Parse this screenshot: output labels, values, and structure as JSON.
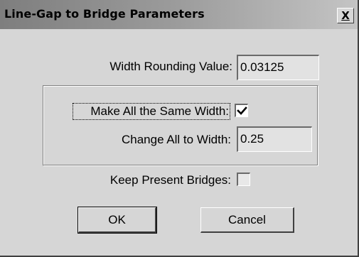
{
  "window": {
    "title": "Line-Gap to Bridge Parameters",
    "close_label": "X"
  },
  "form": {
    "width_rounding_label": "Width Rounding Value:",
    "width_rounding_value": "0.03125",
    "same_width_label": "Make All the Same Width:",
    "same_width_checked": true,
    "change_width_label": "Change All to Width:",
    "change_width_value": "0.25",
    "keep_bridges_label": "Keep Present Bridges:",
    "keep_bridges_checked": false
  },
  "buttons": {
    "ok_label": "OK",
    "cancel_label": "Cancel"
  }
}
